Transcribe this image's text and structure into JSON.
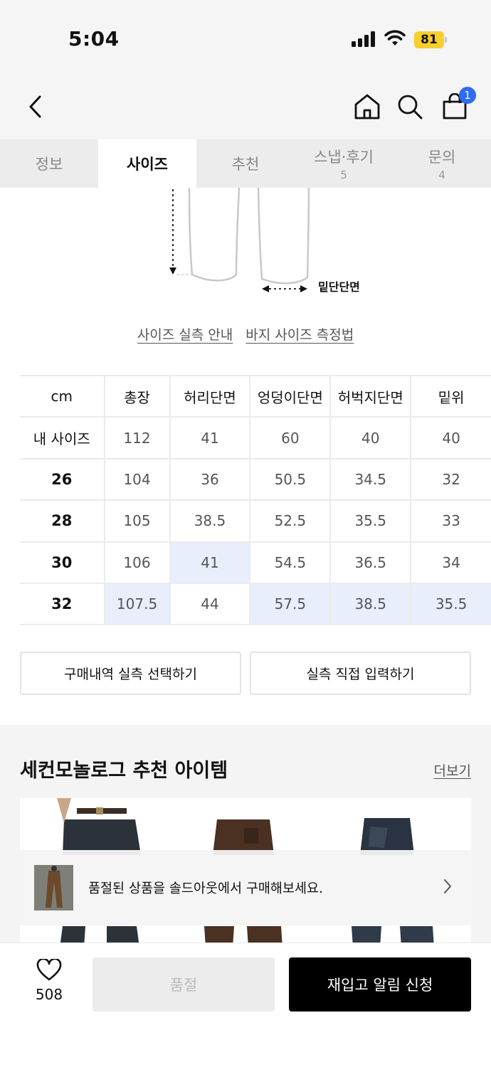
{
  "status_bar": {
    "time": "5:04",
    "battery": "81"
  },
  "header": {
    "cart_count": "1"
  },
  "tabs": [
    {
      "label": "정보",
      "count": ""
    },
    {
      "label": "사이즈",
      "count": ""
    },
    {
      "label": "추천",
      "count": ""
    },
    {
      "label": "스냅·후기",
      "count": "5"
    },
    {
      "label": "문의",
      "count": "4"
    }
  ],
  "diagram": {
    "hem_label": "밑단단면"
  },
  "guide_links": {
    "actual_size_guide": "사이즈 실측 안내",
    "pants_measure": "바지 사이즈 측정법"
  },
  "size_table": {
    "columns": [
      "cm",
      "총장",
      "허리단면",
      "엉덩이단면",
      "허벅지단면",
      "밑위"
    ],
    "rows": [
      {
        "label": "내 사이즈",
        "values": [
          "112",
          "41",
          "60",
          "40",
          "40"
        ]
      },
      {
        "label": "26",
        "values": [
          "104",
          "36",
          "50.5",
          "34.5",
          "32"
        ]
      },
      {
        "label": "28",
        "values": [
          "105",
          "38.5",
          "52.5",
          "35.5",
          "33"
        ]
      },
      {
        "label": "30",
        "values": [
          "106",
          "41",
          "54.5",
          "36.5",
          "34"
        ]
      },
      {
        "label": "32",
        "values": [
          "107.5",
          "44",
          "57.5",
          "38.5",
          "35.5"
        ]
      }
    ]
  },
  "actions": {
    "select_purchase": "구매내역 실측 선택하기",
    "direct_input": "실측 직접 입력하기"
  },
  "recommend": {
    "title": "세컨모놀로그 추천 아이템",
    "more": "더보기"
  },
  "soldout_banner": {
    "text": "품절된 상품을 솔드아웃에서 구매해보세요."
  },
  "bottom_bar": {
    "like_count": "508",
    "soldout_label": "품절",
    "restock_label": "재입고 알림 신청"
  },
  "colors": {
    "accent_blue": "#2f6cf5",
    "highlight": "#e9eefd",
    "battery": "#f8cf2b"
  }
}
